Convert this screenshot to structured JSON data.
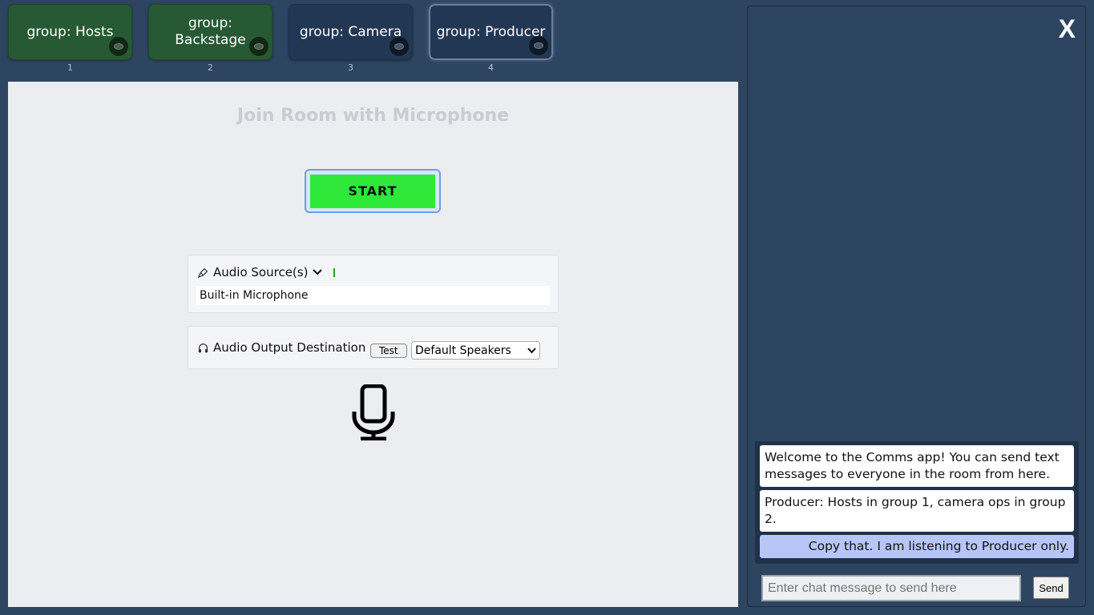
{
  "groups": [
    {
      "label": "group: Hosts",
      "number": "1",
      "style": "green"
    },
    {
      "label": "group: Backstage",
      "number": "2",
      "style": "green"
    },
    {
      "label": "group: Camera",
      "number": "3",
      "style": "dark"
    },
    {
      "label": "group: Producer",
      "number": "4",
      "style": "active"
    }
  ],
  "main": {
    "title": "Join Room with Microphone",
    "start_label": "START",
    "audio_source": {
      "icon": "microphone-icon",
      "label": "Audio Source(s)",
      "chevron": "⌄",
      "selected": "Built-in Microphone"
    },
    "audio_output": {
      "icon": "headphones-icon",
      "label": "Audio Output Destination",
      "test_label": "Test",
      "selected": "Default Speakers"
    }
  },
  "chat": {
    "close_label": "X",
    "messages": [
      {
        "text": "Welcome to the Comms app! You can send text messages to everyone in the room from here.",
        "mine": false
      },
      {
        "text": "Producer: Hosts in group 1, camera ops in group 2.",
        "mine": false
      },
      {
        "text": "Copy that. I am listening to Producer only.",
        "mine": true
      }
    ],
    "input_placeholder": "Enter chat message to send here",
    "send_label": "Send"
  },
  "colors": {
    "background": "#2d4560",
    "start_button": "#2fe83a",
    "group_green": "#275a34",
    "own_message": "#b7c5f7"
  }
}
